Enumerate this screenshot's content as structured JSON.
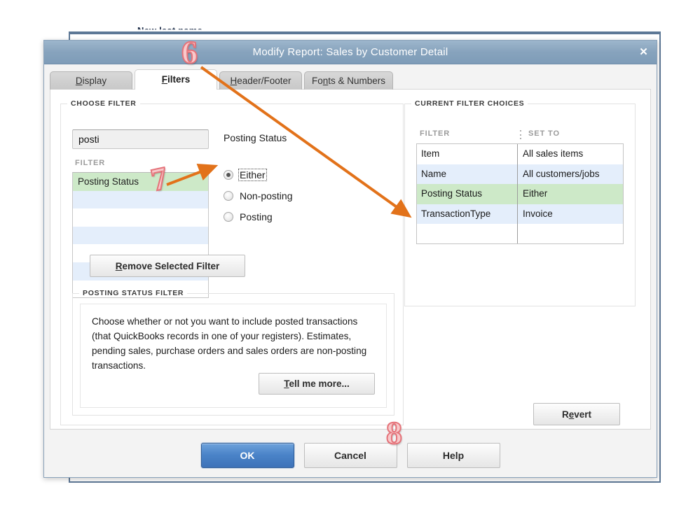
{
  "background": {
    "top_text": "New last name",
    "bottom_fragments": [
      "",
      "",
      "",
      "",
      ""
    ]
  },
  "dialog": {
    "title": "Modify Report: Sales by Customer Detail",
    "close_icon": "close-icon",
    "tabs": [
      {
        "label": "Display",
        "mnemonic_index": 0,
        "active": false
      },
      {
        "label": "Filters",
        "mnemonic_index": 0,
        "active": true
      },
      {
        "label": "Header/Footer",
        "mnemonic_index": 0,
        "active": false
      },
      {
        "label": "Fonts & Numbers",
        "mnemonic_index": 2,
        "active": false
      }
    ]
  },
  "choose_filter": {
    "legend": "CHOOSE FILTER",
    "search": {
      "value": "posti",
      "placeholder": ""
    },
    "list_header": "FILTER",
    "list_items": [
      {
        "label": "Posting Status",
        "selected": true
      },
      {
        "label": "",
        "selected": false
      },
      {
        "label": "",
        "selected": false
      },
      {
        "label": "",
        "selected": false
      },
      {
        "label": "",
        "selected": false
      },
      {
        "label": "",
        "selected": false
      },
      {
        "label": "",
        "selected": false
      }
    ],
    "detail_title": "Posting Status",
    "radios": [
      {
        "label": "Either",
        "checked": true,
        "focused": true
      },
      {
        "label": "Non-posting",
        "checked": false,
        "focused": false
      },
      {
        "label": "Posting",
        "checked": false,
        "focused": false
      }
    ]
  },
  "description": {
    "legend": "POSTING STATUS FILTER",
    "text": "Choose whether or not you want to include posted transactions (that QuickBooks records in one of your registers). Estimates, pending sales, purchase orders and sales orders are non-posting transactions.",
    "tell_me_more_label": "Tell me more..."
  },
  "current_filters": {
    "legend": "CURRENT FILTER CHOICES",
    "columns": [
      "FILTER",
      "SET TO"
    ],
    "rows": [
      {
        "filter": "Item",
        "set_to": "All sales items",
        "selected": false
      },
      {
        "filter": "Name",
        "set_to": "All customers/jobs",
        "selected": false
      },
      {
        "filter": "Posting Status",
        "set_to": "Either",
        "selected": true
      },
      {
        "filter": "TransactionType",
        "set_to": "Invoice",
        "selected": false
      },
      {
        "filter": "",
        "set_to": "",
        "selected": false
      }
    ],
    "remove_label": "Remove Selected Filter",
    "revert_label": "Revert"
  },
  "footer": {
    "ok_label": "OK",
    "cancel_label": "Cancel",
    "help_label": "Help"
  },
  "annotations": [
    {
      "id": "6",
      "label": "6"
    },
    {
      "id": "7",
      "label": "7"
    },
    {
      "id": "8",
      "label": "8"
    }
  ],
  "colors": {
    "accent_blue": "#4a83c8",
    "title_bar": "#87a3bd",
    "selected_row_green": "#cde9c8",
    "alt_row_blue": "#e4eefb",
    "annotation_orange": "#e2721a",
    "annotation_pink": "#f8c9cb"
  }
}
